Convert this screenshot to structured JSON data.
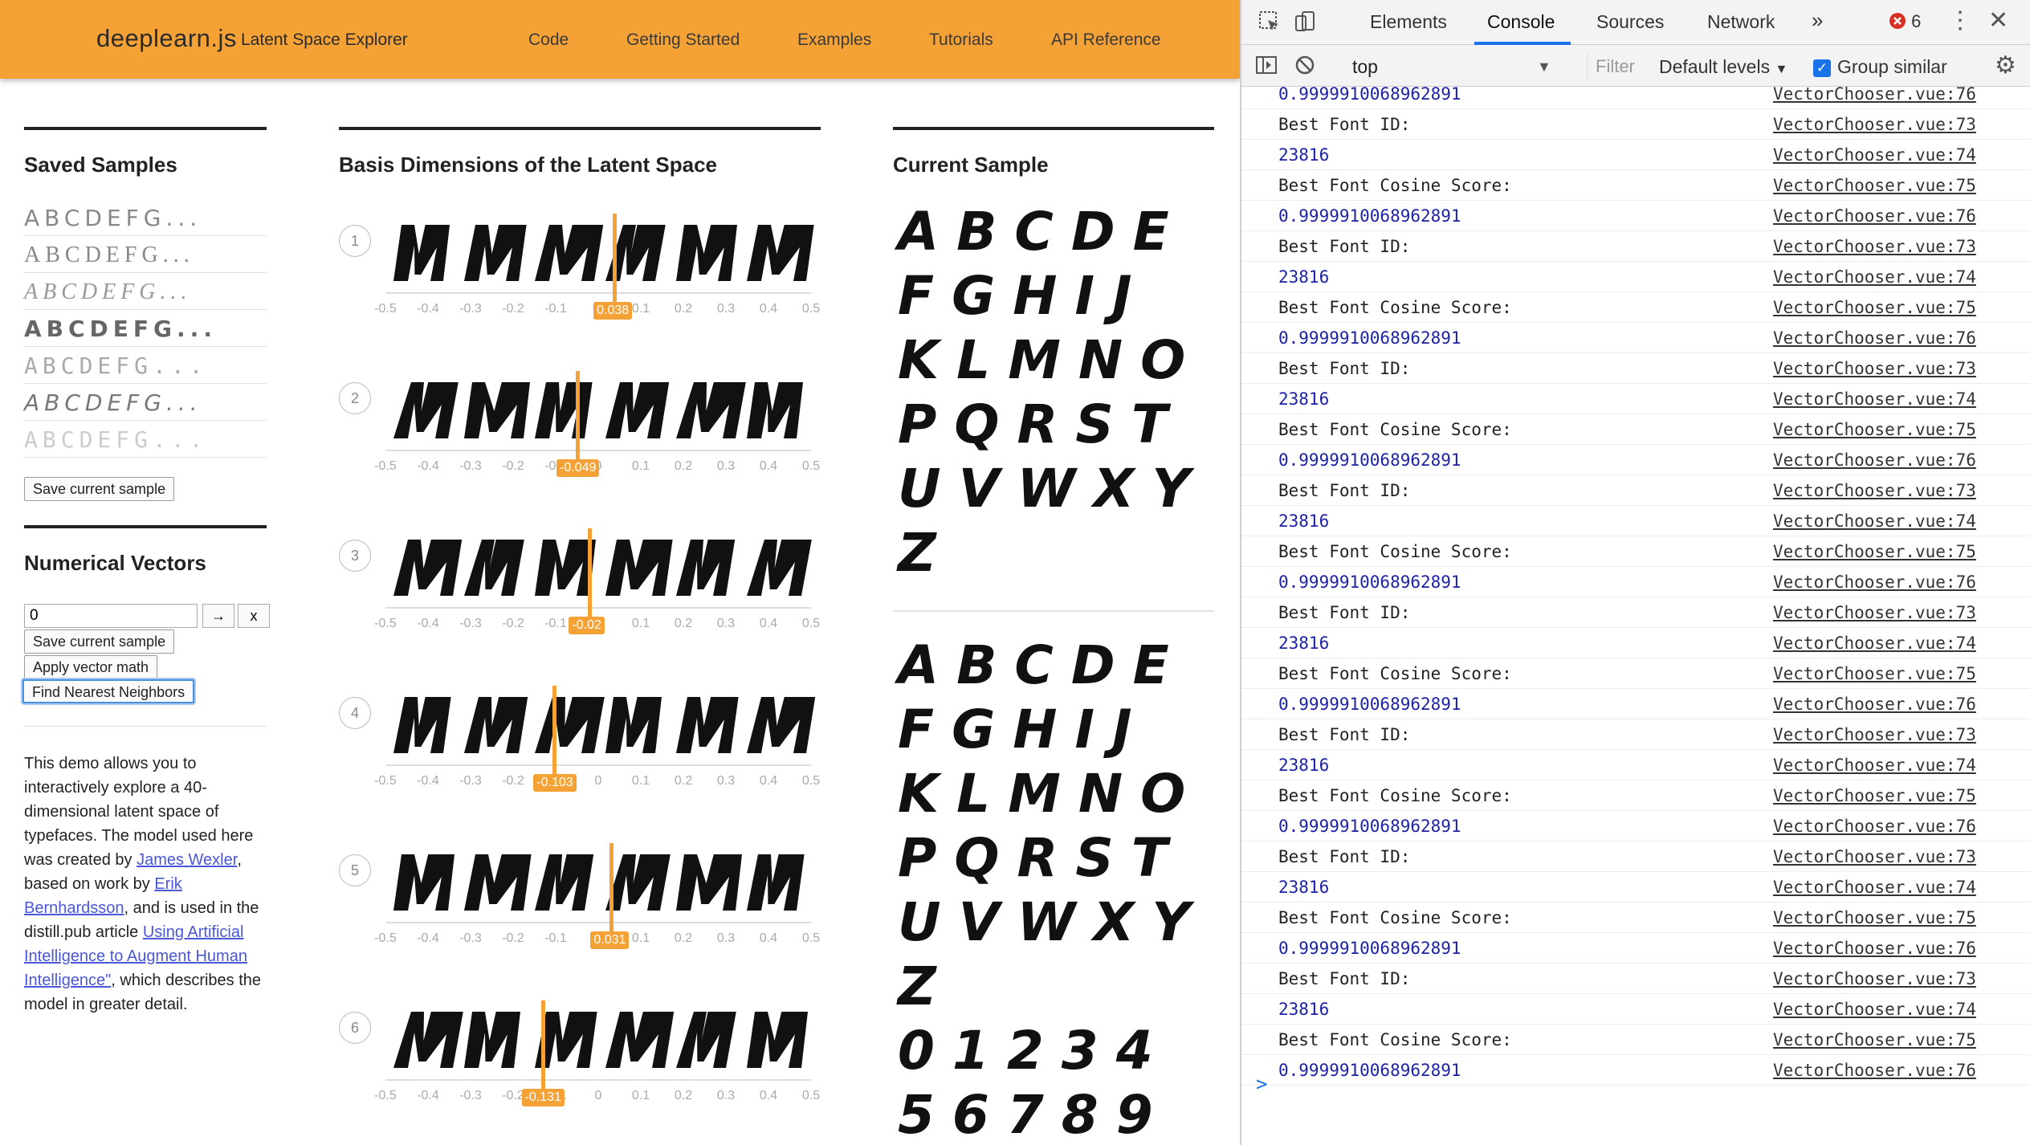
{
  "header": {
    "brand": "deeplearn.js",
    "subtitle": "Latent Space Explorer",
    "nav": [
      "Code",
      "Getting Started",
      "Examples",
      "Tutorials",
      "API Reference"
    ]
  },
  "saved_samples": {
    "title": "Saved Samples",
    "rows": [
      "ABCDEFG...",
      "ABCDEFG...",
      "ABCDEFG...",
      "ABCDEFG...",
      "ABCDEFG...",
      "ABCDEFG...",
      "ABCDEFG..."
    ],
    "save_button": "Save current sample"
  },
  "numerical_vectors": {
    "title": "Numerical Vectors",
    "input_value": "0",
    "arrow_button": "→",
    "clear_button": "x",
    "save_button": "Save current sample",
    "apply_button": "Apply vector math",
    "neighbors_button": "Find Nearest Neighbors"
  },
  "description": {
    "p1": "This demo allows you to interactively explore a 40-dimensional latent space of typefaces. The model used here was created by ",
    "link1": "James Wexler",
    "p2": ", based on work by ",
    "link2": "Erik Bernhardsson",
    "p3": ", and is used in the distill.pub article ",
    "link3": "Using Artificial Intelligence to Augment Human Intelligence\"",
    "p4": ", which describes the model in greater detail."
  },
  "basis": {
    "title": "Basis Dimensions of the Latent Space",
    "ticks": [
      "-0.5",
      "-0.4",
      "-0.3",
      "-0.2",
      "-0.1",
      "0",
      "0.1",
      "0.2",
      "0.3",
      "0.4",
      "0.5"
    ],
    "dimensions": [
      {
        "num": "1",
        "value": 0.038,
        "label": "0.038"
      },
      {
        "num": "2",
        "value": -0.049,
        "label": "-0.049"
      },
      {
        "num": "3",
        "value": -0.02,
        "label": "-0.02"
      },
      {
        "num": "4",
        "value": -0.103,
        "label": "-0.103"
      },
      {
        "num": "5",
        "value": 0.031,
        "label": "0.031"
      },
      {
        "num": "6",
        "value": -0.131,
        "label": "-0.131"
      }
    ]
  },
  "current_sample": {
    "title": "Current Sample",
    "sample1": [
      "ABCDE",
      "FGHIJ",
      "KLMNO",
      "PQRST",
      "UVWXY",
      "Z"
    ],
    "sample2": [
      "ABCDE",
      "FGHIJ",
      "KLMNO",
      "PQRST",
      "UVWXY",
      "Z",
      "01234",
      "56789"
    ]
  },
  "devtools": {
    "tabs": [
      "Elements",
      "Console",
      "Sources",
      "Network"
    ],
    "more": "»",
    "error_count": "6",
    "context": "top",
    "filter_placeholder": "Filter",
    "levels": "Default levels",
    "group_similar": "Group similar",
    "prompt": ">",
    "logs": [
      {
        "msg": "0.9999910068962891",
        "num": true,
        "src": "VectorChooser.vue:76"
      },
      {
        "msg": "Best Font ID:",
        "num": false,
        "src": "VectorChooser.vue:73"
      },
      {
        "msg": "23816",
        "num": true,
        "src": "VectorChooser.vue:74"
      },
      {
        "msg": "Best Font Cosine Score:",
        "num": false,
        "src": "VectorChooser.vue:75"
      },
      {
        "msg": "0.9999910068962891",
        "num": true,
        "src": "VectorChooser.vue:76"
      },
      {
        "msg": "Best Font ID:",
        "num": false,
        "src": "VectorChooser.vue:73"
      },
      {
        "msg": "23816",
        "num": true,
        "src": "VectorChooser.vue:74"
      },
      {
        "msg": "Best Font Cosine Score:",
        "num": false,
        "src": "VectorChooser.vue:75"
      },
      {
        "msg": "0.9999910068962891",
        "num": true,
        "src": "VectorChooser.vue:76"
      },
      {
        "msg": "Best Font ID:",
        "num": false,
        "src": "VectorChooser.vue:73"
      },
      {
        "msg": "23816",
        "num": true,
        "src": "VectorChooser.vue:74"
      },
      {
        "msg": "Best Font Cosine Score:",
        "num": false,
        "src": "VectorChooser.vue:75"
      },
      {
        "msg": "0.9999910068962891",
        "num": true,
        "src": "VectorChooser.vue:76"
      },
      {
        "msg": "Best Font ID:",
        "num": false,
        "src": "VectorChooser.vue:73"
      },
      {
        "msg": "23816",
        "num": true,
        "src": "VectorChooser.vue:74"
      },
      {
        "msg": "Best Font Cosine Score:",
        "num": false,
        "src": "VectorChooser.vue:75"
      },
      {
        "msg": "0.9999910068962891",
        "num": true,
        "src": "VectorChooser.vue:76"
      },
      {
        "msg": "Best Font ID:",
        "num": false,
        "src": "VectorChooser.vue:73"
      },
      {
        "msg": "23816",
        "num": true,
        "src": "VectorChooser.vue:74"
      },
      {
        "msg": "Best Font Cosine Score:",
        "num": false,
        "src": "VectorChooser.vue:75"
      },
      {
        "msg": "0.9999910068962891",
        "num": true,
        "src": "VectorChooser.vue:76"
      },
      {
        "msg": "Best Font ID:",
        "num": false,
        "src": "VectorChooser.vue:73"
      },
      {
        "msg": "23816",
        "num": true,
        "src": "VectorChooser.vue:74"
      },
      {
        "msg": "Best Font Cosine Score:",
        "num": false,
        "src": "VectorChooser.vue:75"
      },
      {
        "msg": "0.9999910068962891",
        "num": true,
        "src": "VectorChooser.vue:76"
      },
      {
        "msg": "Best Font ID:",
        "num": false,
        "src": "VectorChooser.vue:73"
      },
      {
        "msg": "23816",
        "num": true,
        "src": "VectorChooser.vue:74"
      },
      {
        "msg": "Best Font Cosine Score:",
        "num": false,
        "src": "VectorChooser.vue:75"
      },
      {
        "msg": "0.9999910068962891",
        "num": true,
        "src": "VectorChooser.vue:76"
      },
      {
        "msg": "Best Font ID:",
        "num": false,
        "src": "VectorChooser.vue:73"
      },
      {
        "msg": "23816",
        "num": true,
        "src": "VectorChooser.vue:74"
      },
      {
        "msg": "Best Font Cosine Score:",
        "num": false,
        "src": "VectorChooser.vue:75"
      },
      {
        "msg": "0.9999910068962891",
        "num": true,
        "src": "VectorChooser.vue:76"
      }
    ]
  },
  "colors": {
    "accent": "#f4a235",
    "link": "#4a57d6",
    "console_number": "#1c22a6",
    "devtools_active": "#1a73e8"
  }
}
